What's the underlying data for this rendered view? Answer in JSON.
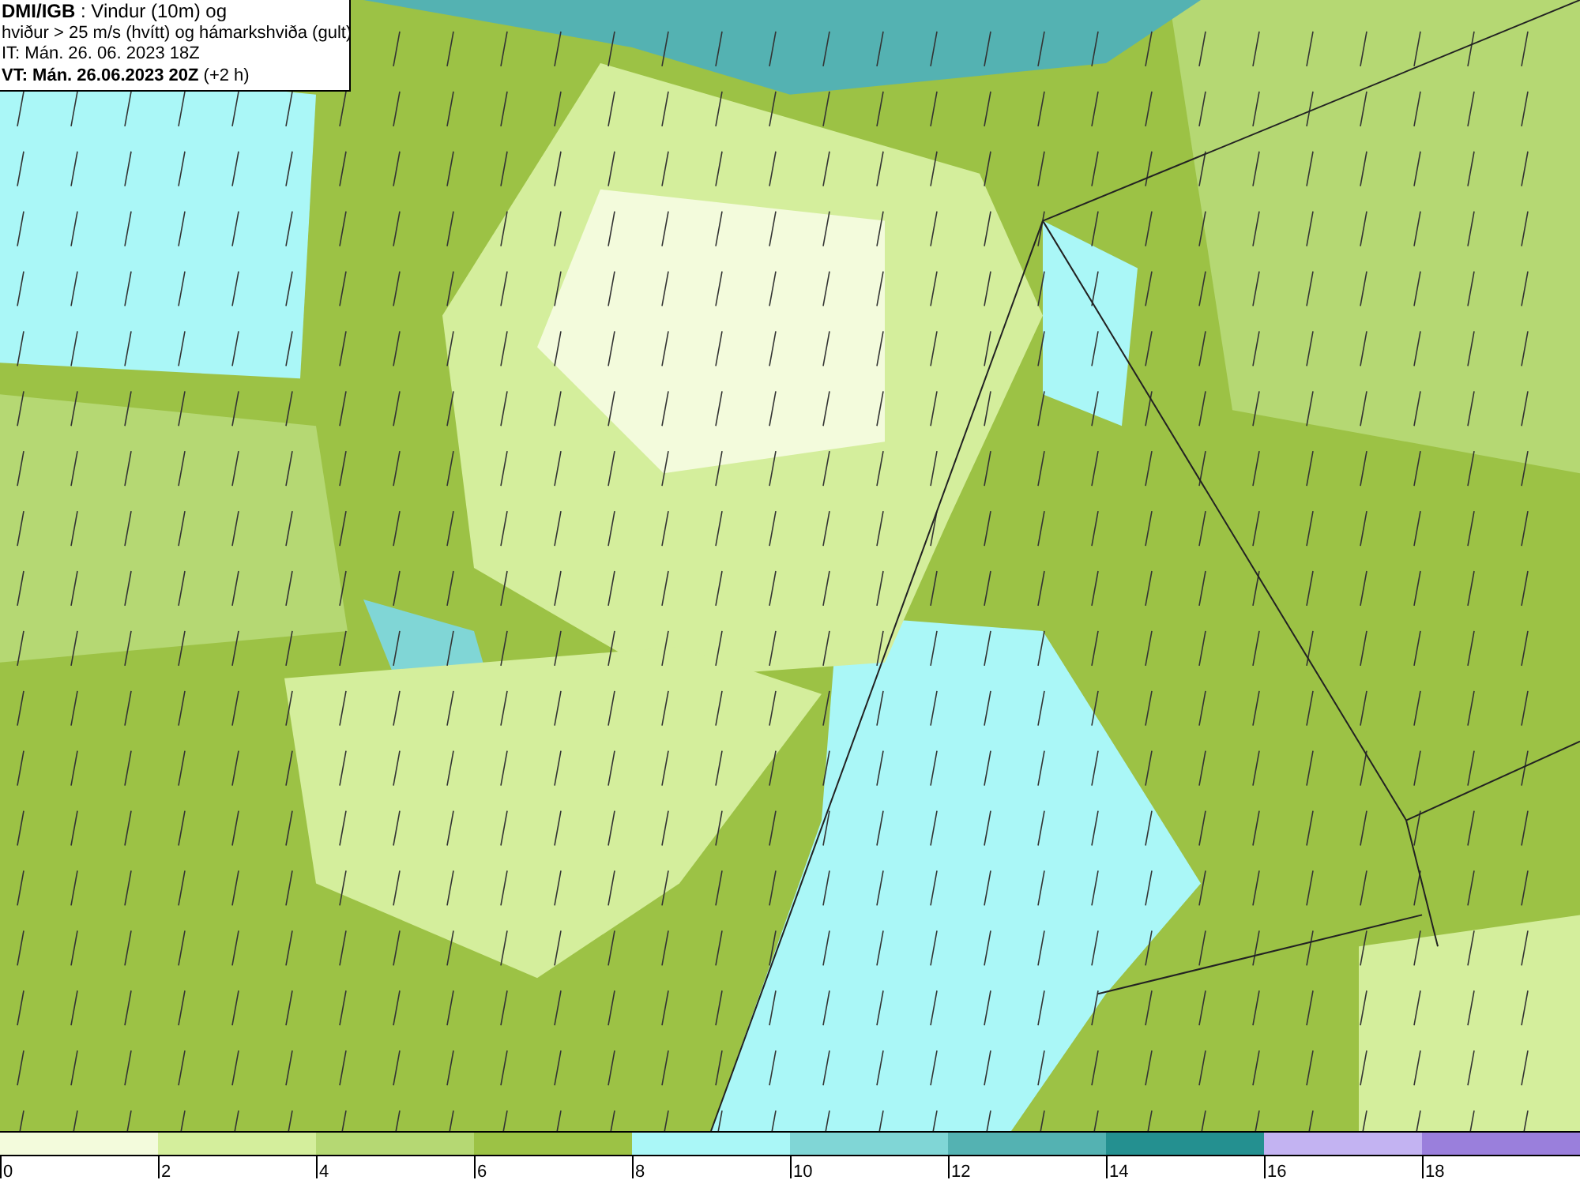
{
  "title_box": {
    "lines": [
      "**DMI/IGB** : Vindur (10m) og",
      "hviður > 25 m/s (hvítt) og hámarkshviða (gult)",
      "IT: Mán. 26. 06. 2023 18Z",
      "**VT: Mán. 26.06.2023 20Z** (+2 h)"
    ]
  },
  "legend": {
    "bins": [
      {
        "color": "#f3fbdc",
        "label": "0"
      },
      {
        "color": "#d4ee9c",
        "label": "2"
      },
      {
        "color": "#b5d873",
        "label": "4"
      },
      {
        "color": "#9cc245",
        "label": "6"
      },
      {
        "color": "#aaf7f7",
        "label": "8"
      },
      {
        "color": "#80d6d6",
        "label": "10"
      },
      {
        "color": "#54b2b2",
        "label": "12"
      },
      {
        "color": "#249090",
        "label": "14"
      },
      {
        "color": "#c3b3f2",
        "label": "16"
      },
      {
        "color": "#9a7fdc",
        "label": "18"
      }
    ]
  }
}
